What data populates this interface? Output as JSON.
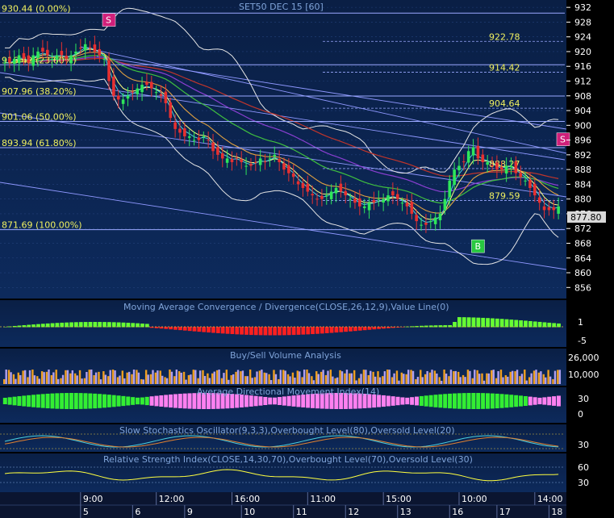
{
  "chart_data": [
    {
      "type": "candlestick",
      "title": "SET50 DEC 15  [60]",
      "last_price": "877.80",
      "ylim": [
        853,
        934
      ],
      "y_ticks": [
        "932",
        "928",
        "924",
        "920",
        "916",
        "912",
        "908",
        "904",
        "900",
        "896",
        "892",
        "888",
        "884",
        "880",
        "876",
        "872",
        "868",
        "864",
        "860",
        "856"
      ],
      "fib_levels": [
        {
          "label": "930.44 (0.00%)",
          "value": 930.44
        },
        {
          "label": "916.42 (23.60%)",
          "value": 916.42
        },
        {
          "label": "907.96 (38.20%)",
          "value": 907.96
        },
        {
          "label": "901.06 (50.00%)",
          "value": 901.06
        },
        {
          "label": "893.94 (61.80%)",
          "value": 893.94
        },
        {
          "label": "871.69 (100.00%)",
          "value": 871.69
        }
      ],
      "right_fib_levels": [
        {
          "label": "922.78",
          "value": 922.78
        },
        {
          "label": "914.42",
          "value": 914.42
        },
        {
          "label": "904.64",
          "value": 904.64
        },
        {
          "label": "888.27",
          "value": 888.27
        },
        {
          "label": "879.59",
          "value": 879.59
        }
      ],
      "signals": [
        {
          "label": "S",
          "kind": "sell",
          "x": 22,
          "price": 928.6
        },
        {
          "label": "B",
          "kind": "buy",
          "x": 100,
          "price": 867.2
        },
        {
          "label": "S",
          "kind": "sell",
          "x": 118,
          "price": 896.2
        }
      ],
      "x_tick_times": [
        {
          "label": "9:00",
          "x": 16
        },
        {
          "label": "12:00",
          "x": 32
        },
        {
          "label": "16:00",
          "x": 48
        },
        {
          "label": "11:00",
          "x": 64
        },
        {
          "label": "15:00",
          "x": 80
        },
        {
          "label": "10:00",
          "x": 96
        },
        {
          "label": "14:00",
          "x": 112
        }
      ],
      "x_tick_days": [
        {
          "label": "5",
          "x": 16
        },
        {
          "label": "6",
          "x": 27
        },
        {
          "label": "9",
          "x": 38
        },
        {
          "label": "10",
          "x": 50
        },
        {
          "label": "11",
          "x": 61
        },
        {
          "label": "12",
          "x": 72
        },
        {
          "label": "13",
          "x": 83
        },
        {
          "label": "16",
          "x": 94
        },
        {
          "label": "17",
          "x": 104
        },
        {
          "label": "18",
          "x": 115
        }
      ],
      "closes": [
        917,
        917,
        918,
        919,
        918,
        917,
        919,
        920,
        920,
        919,
        918,
        919,
        919,
        918,
        919,
        920,
        921,
        922,
        921,
        920,
        919,
        918,
        912,
        908,
        907,
        907,
        908,
        909,
        910,
        911,
        911,
        910,
        909,
        908,
        906,
        902,
        899,
        898,
        897,
        897,
        896,
        896,
        897,
        896,
        893,
        892,
        891,
        891,
        890,
        891,
        890,
        889,
        889,
        890,
        891,
        890,
        891,
        892,
        890,
        888,
        887,
        886,
        884,
        883,
        882,
        881,
        880,
        880,
        881,
        882,
        883,
        882,
        881,
        880,
        879,
        878,
        878,
        879,
        879,
        880,
        880,
        881,
        881,
        880,
        879,
        878,
        876,
        874,
        873,
        873,
        874,
        875,
        876,
        880,
        885,
        888,
        889,
        890,
        893,
        894,
        891,
        890,
        890,
        889,
        888,
        888,
        889,
        889,
        887,
        886,
        885,
        883,
        881,
        879,
        877,
        877,
        877,
        878
      ]
    },
    {
      "type": "area",
      "title": "Moving Average Convergence / Divergence(CLOSE,26,12,9),Value Line(0)",
      "y_ticks": [
        "1",
        "-5"
      ]
    },
    {
      "type": "bar",
      "title": "Buy/Sell Volume Analysis",
      "y_ticks": [
        "26,000",
        "10,000"
      ]
    },
    {
      "type": "area",
      "title": "Average Directional Movement Index(14)",
      "y_ticks": [
        "30",
        "0"
      ]
    },
    {
      "type": "line",
      "title": "Slow Stochastics Oscillator(9,3,3),Overbought Level(80),Oversold Level(20)",
      "y_ticks": [
        "30"
      ]
    },
    {
      "type": "line",
      "title": "Relative Strength Index(CLOSE,14,30,70),Overbought Level(70),Oversold Level(30)",
      "y_ticks": [
        "60",
        "30"
      ]
    }
  ]
}
